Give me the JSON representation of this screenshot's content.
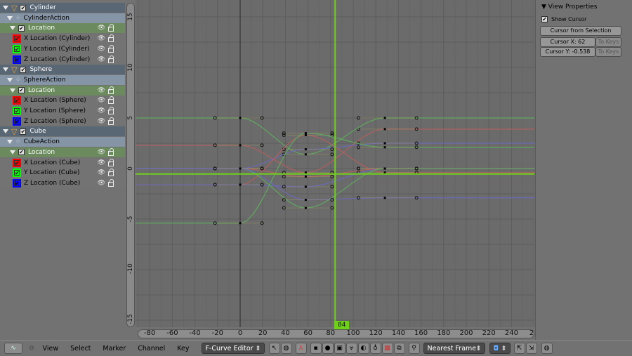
{
  "channels": [
    {
      "type": "obj",
      "label": "Cylinder"
    },
    {
      "type": "act",
      "label": "CylinderAction"
    },
    {
      "type": "grp",
      "label": "Location"
    },
    {
      "type": "ch",
      "label": "X Location (Cylinder)",
      "color": "#ff0000"
    },
    {
      "type": "ch",
      "label": "Y Location (Cylinder)",
      "color": "#00ff00"
    },
    {
      "type": "ch",
      "label": "Z Location (Cylinder)",
      "color": "#0000ff"
    },
    {
      "type": "obj",
      "label": "Sphere"
    },
    {
      "type": "act",
      "label": "SphereAction"
    },
    {
      "type": "grp",
      "label": "Location"
    },
    {
      "type": "ch",
      "label": "X Location (Sphere)",
      "color": "#ff0000"
    },
    {
      "type": "ch",
      "label": "Y Location (Sphere)",
      "color": "#00ff00"
    },
    {
      "type": "ch",
      "label": "Z Location (Sphere)",
      "color": "#0000ff"
    },
    {
      "type": "obj",
      "label": "Cube"
    },
    {
      "type": "act",
      "label": "CubeAction"
    },
    {
      "type": "grp",
      "label": "Location"
    },
    {
      "type": "ch",
      "label": "X Location (Cube)",
      "color": "#ff0000"
    },
    {
      "type": "ch",
      "label": "Y Location (Cube)",
      "color": "#00ff00"
    },
    {
      "type": "ch",
      "label": "Z Location (Cube)",
      "color": "#0000ff"
    }
  ],
  "graph": {
    "y_ticks": [
      "15",
      "10",
      "5",
      "0",
      "-5",
      "-10",
      "-15"
    ],
    "x_ticks": [
      "-80",
      "-60",
      "-40",
      "-20",
      "0",
      "20",
      "40",
      "60",
      "80",
      "100",
      "120",
      "140",
      "160",
      "180",
      "200",
      "220",
      "240",
      "2"
    ],
    "current_frame": "84",
    "key_frames": [
      0,
      58,
      128
    ],
    "curves": [
      {
        "name": "X Location (Cylinder)",
        "color": "#b06060",
        "values": [
          2.3,
          -0.4,
          3.9
        ]
      },
      {
        "name": "Y Location (Cylinder)",
        "color": "#60a860",
        "values": [
          5.0,
          1.4,
          5.0
        ]
      },
      {
        "name": "Z Location (Cylinder)",
        "color": "#6a6ab8",
        "values": [
          0.0,
          1.9,
          2.5
        ]
      },
      {
        "name": "X Location (Sphere)",
        "color": "#b06060",
        "values": [
          -1.6,
          3.3,
          -0.4
        ]
      },
      {
        "name": "Y Location (Sphere)",
        "color": "#60a860",
        "values": [
          -5.4,
          3.5,
          2.1
        ]
      },
      {
        "name": "Z Location (Sphere)",
        "color": "#6a6ab8",
        "values": [
          -1.6,
          -1.8,
          0.0
        ]
      },
      {
        "name": "X Location (Cube)",
        "color": "#b06060",
        "values": [
          0.0,
          -0.8,
          0.0
        ]
      },
      {
        "name": "Y Location (Cube)",
        "color": "#60a860",
        "values": [
          0.0,
          -3.9,
          0.0
        ]
      },
      {
        "name": "Z Location (Cube)",
        "color": "#6a6ab8",
        "values": [
          0.0,
          -3.1,
          -2.9
        ]
      }
    ],
    "cursor_color": "#6fd01c"
  },
  "properties": {
    "title": "View Properties",
    "show_cursor_label": "Show Cursor",
    "show_cursor": true,
    "cursor_from_selection": "Cursor from Selection",
    "cursor_x": "Cursor X: 62",
    "cursor_y": "Cursor Y: -0.538",
    "to_keys": "To Keys"
  },
  "header": {
    "menus": [
      "View",
      "Select",
      "Marker",
      "Channel",
      "Key"
    ],
    "mode": "F-Curve Editor",
    "snap": "Nearest Frame"
  }
}
